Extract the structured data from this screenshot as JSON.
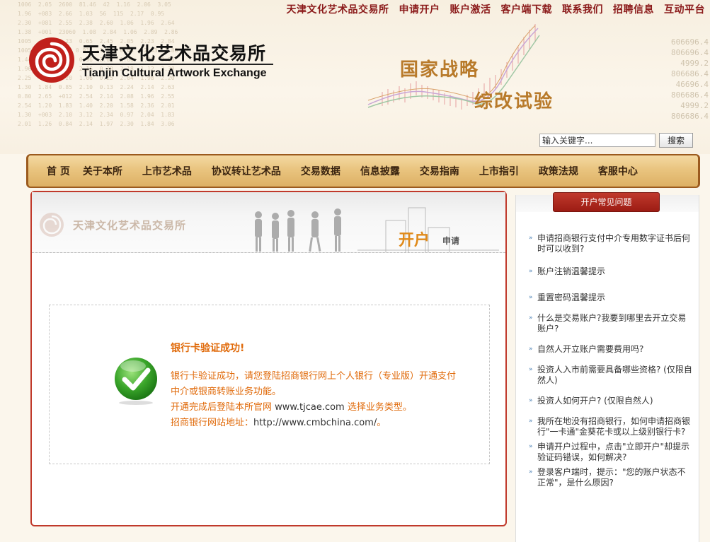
{
  "header": {
    "top_links": [
      "天津文化艺术品交易所",
      "申请开户",
      "账户激活",
      "客户端下载",
      "联系我们",
      "招聘信息",
      "互动平台"
    ],
    "logo_cn": "天津文化艺术品交易所",
    "logo_en": "Tianjin Cultural Artwork Exchange",
    "slogan_1": "国家战略",
    "slogan_2": "综改试验",
    "search_placeholder": "输入关键字...",
    "search_button": "搜索",
    "right_numbers": [
      "606696.4",
      "806696.4",
      "4999.2",
      "806686.4",
      "46696.4",
      "806686.4",
      "4999.2",
      "806686.4"
    ]
  },
  "nav": {
    "items": [
      "首 页",
      "关于本所",
      "上市艺术品",
      "协议转让艺术品",
      "交易数据",
      "信息披露",
      "交易指南",
      "上市指引",
      "政策法规",
      "客服中心"
    ]
  },
  "main": {
    "watermark": "天津文化艺术品交易所",
    "head_title": "开户",
    "head_sub": "申请",
    "msg_title": "银行卡验证成功!",
    "msg_line1": "银行卡验证成功，请您登陆招商银行网上个人银行（专业版）开通支付中介或银商转账业务功能。",
    "msg_line2a": "开通完成后登陆本所官网",
    "msg_line2b": "www.tjcae.com",
    "msg_line2c": "选择业务类型。",
    "msg_line3a": "招商银行网站地址：",
    "msg_line3b": "http://www.cmbchina.com/",
    "msg_line3c": "。"
  },
  "side": {
    "tab_label": "开户常见问题",
    "faq": [
      "申请招商银行支付中介专用数字证书后何时可以收到?",
      "账户注销温馨提示",
      "重置密码温馨提示",
      "什么是交易账户?我要到哪里去开立交易账户?",
      "自然人开立账户需要费用吗?",
      "投资人入市前需要具备哪些资格? (仅限自然人)",
      "投资人如何开户? (仅限自然人)",
      "我所在地没有招商银行，如何申请招商银行\"一卡通\"金葵花卡或以上级别银行卡?",
      "申请开户过程中，点击\"立即开户\"却提示验证码错误，如何解决?",
      "登录客户端时，提示：\"您的账户状态不正常\"，是什么原因?"
    ]
  },
  "colors": {
    "brand_red": "#8b1a1a",
    "accent_orange": "#e06a0a",
    "panel_border": "#c0392b"
  }
}
